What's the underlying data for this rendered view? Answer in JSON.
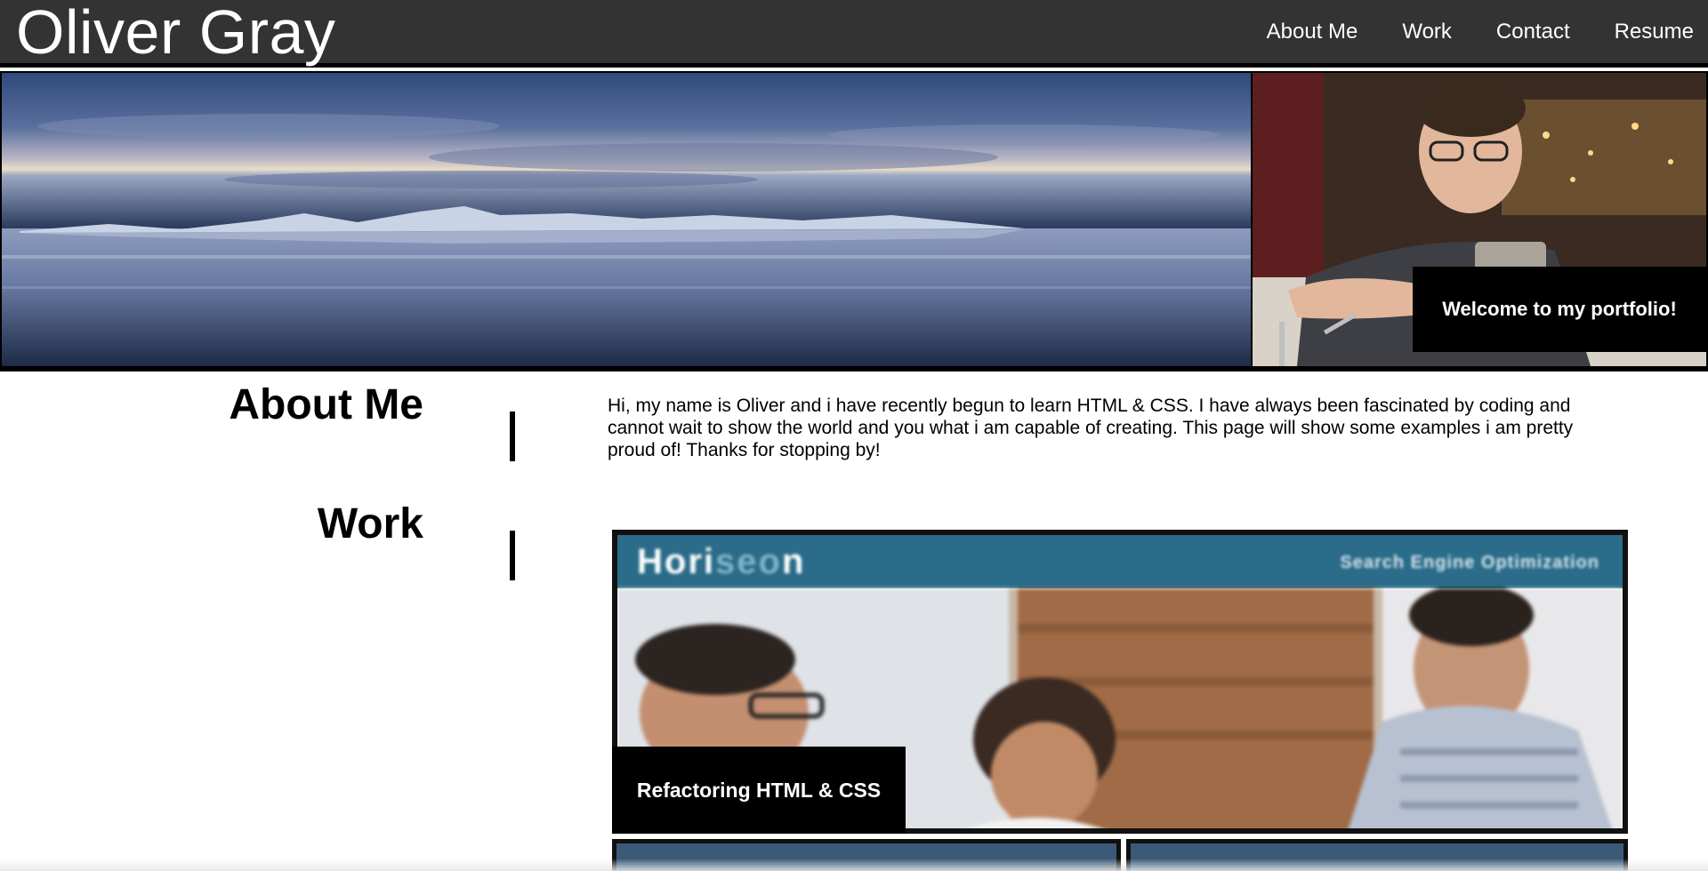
{
  "header": {
    "site_title": "Oliver Gray",
    "nav": [
      {
        "label": "About Me"
      },
      {
        "label": "Work"
      },
      {
        "label": "Contact"
      },
      {
        "label": "Resume"
      }
    ],
    "background_color": "#333333"
  },
  "hero": {
    "welcome_text": "Welcome to my portfolio!"
  },
  "about": {
    "heading": "About Me",
    "text": "Hi, my name is Oliver and i have recently begun to learn HTML & CSS. I have always been fascinated by coding and cannot wait to show the world and you what i am capable of creating. This page will show some examples i am pretty proud of! Thanks for stopping by!"
  },
  "work": {
    "heading": "Work",
    "featured": {
      "logo_prefix": "Hori",
      "logo_accent": "seo",
      "logo_suffix": "n",
      "tagline": "Search Engine Optimization",
      "label": "Refactoring HTML & CSS",
      "header_color": "#2a6c89"
    }
  }
}
